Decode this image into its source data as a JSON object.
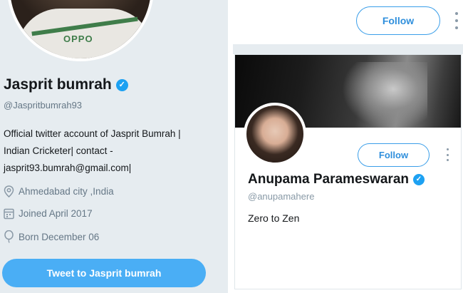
{
  "left_profile": {
    "name": "Jasprit bumrah",
    "handle": "@Jaspritbumrah93",
    "bio_lines": [
      "Official twitter account of Jasprit Bumrah |",
      "Indian Cricketer| contact -",
      "jasprit93.bumrah@gmail.com|"
    ],
    "location": "Ahmedabad city ,India",
    "joined": "Joined April 2017",
    "born": "Born December 06",
    "tweet_to_label": "Tweet to Jasprit bumrah",
    "photo_sponsor_text": "OPPO",
    "verified_badge": "✓"
  },
  "right_profile": {
    "top_follow_label": "Follow",
    "card_follow_label": "Follow",
    "name": "Anupama Parameswaran",
    "handle": "@anupamahere",
    "bio": "Zero to Zen",
    "verified_badge": "✓"
  },
  "icons": [
    "location-pin-icon",
    "calendar-icon",
    "balloon-icon",
    "verified-icon",
    "more-options-icon"
  ],
  "colors": {
    "accent": "#1da1f2",
    "button_fill": "#4aaef5",
    "panel_background": "#e6ecf0",
    "secondary_text": "#657786"
  }
}
